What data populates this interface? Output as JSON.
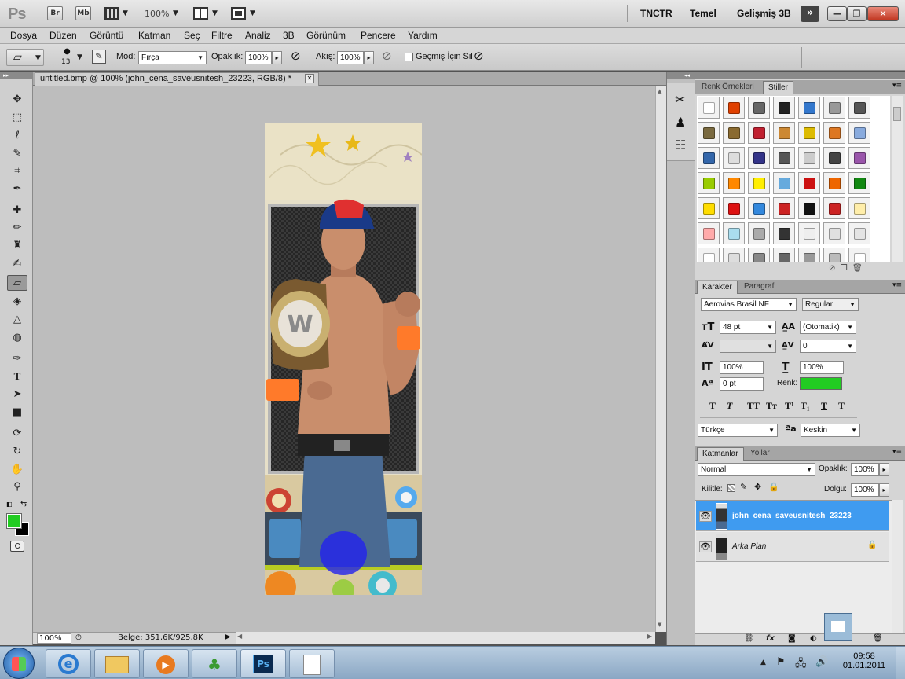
{
  "appbar": {
    "logo": "Ps",
    "btn_br": "Br",
    "btn_mb": "Mb",
    "zoom": "100%",
    "workspaces": [
      "TNCTR",
      "Temel",
      "Gelişmiş 3B"
    ]
  },
  "menu": [
    "Dosya",
    "Düzen",
    "Görüntü",
    "Katman",
    "Seç",
    "Filtre",
    "Analiz",
    "3B",
    "Görünüm",
    "Pencere",
    "Yardım"
  ],
  "options": {
    "brush_size": "13",
    "mode_label": "Mod:",
    "mode_value": "Fırça",
    "opacity_label": "Opaklık:",
    "opacity_value": "100%",
    "flow_label": "Akış:",
    "flow_value": "100%",
    "history_label": "Geçmiş İçin Sil"
  },
  "document": {
    "tab_title": "untitled.bmp @ 100% (john_cena_saveusnitesh_23223, RGB/8) *",
    "zoom": "100%",
    "status": "Belge: 351,6K/925,8K"
  },
  "swatches_panel": {
    "tabs": [
      "Renk Örnekleri",
      "Stiller"
    ],
    "styles": [
      "#ffffff",
      "#e04000",
      "#666666",
      "#222222",
      "#3377cc",
      "#999999",
      "#555555",
      "#7a6a40",
      "#8a6a30",
      "#c02030",
      "#cc8833",
      "#ddbb00",
      "#dd7722",
      "#88aadd",
      "#3366aa",
      "#dddddd",
      "#333388",
      "#555555",
      "#cccccc",
      "#444444",
      "#9955aa",
      "#99cc00",
      "#ff8800",
      "#ffee00",
      "#66aadd",
      "#cc1111",
      "#ee6600",
      "#118811",
      "#ffdd00",
      "#dd1111",
      "#3388dd",
      "#cc2222",
      "#111111",
      "#cc2222",
      "#ffeeaa",
      "#ffaaaa",
      "#aaddee",
      "#aaaaaa",
      "#333333",
      "#eeeeee",
      "#e0e0e0",
      "#e4e4e4",
      "#ffffff",
      "#dddddd",
      "#888888",
      "#666666",
      "#999999",
      "#bbbbbb",
      "#ffffff"
    ]
  },
  "character_panel": {
    "tabs": [
      "Karakter",
      "Paragraf"
    ],
    "font_family": "Aerovias Brasil NF",
    "font_style": "Regular",
    "font_size": "48 pt",
    "leading": "(Otomatik)",
    "kerning": "",
    "tracking": "0",
    "vscale": "100%",
    "hscale": "100%",
    "baseline": "0 pt",
    "color_label": "Renk:",
    "color": "#22cc22",
    "language": "Türkçe",
    "antialias": "Keskin",
    "type_buttons": [
      "T",
      "T",
      "TT",
      "Tт",
      "T¹",
      "T₁",
      "T",
      "Ŧ"
    ]
  },
  "layers_panel": {
    "tabs": [
      "Katmanlar",
      "Yollar"
    ],
    "blend_mode": "Normal",
    "opacity_label": "Opaklık:",
    "opacity": "100%",
    "lock_label": "Kilitle:",
    "fill_label": "Dolgu:",
    "fill": "100%",
    "layers": [
      {
        "name": "john_cena_saveusnitesh_23223",
        "selected": true
      },
      {
        "name": "Arka Plan",
        "selected": false
      }
    ]
  },
  "taskbar": {
    "time": "09:58",
    "date": "01.01.2011",
    "ps_label": "Ps"
  }
}
